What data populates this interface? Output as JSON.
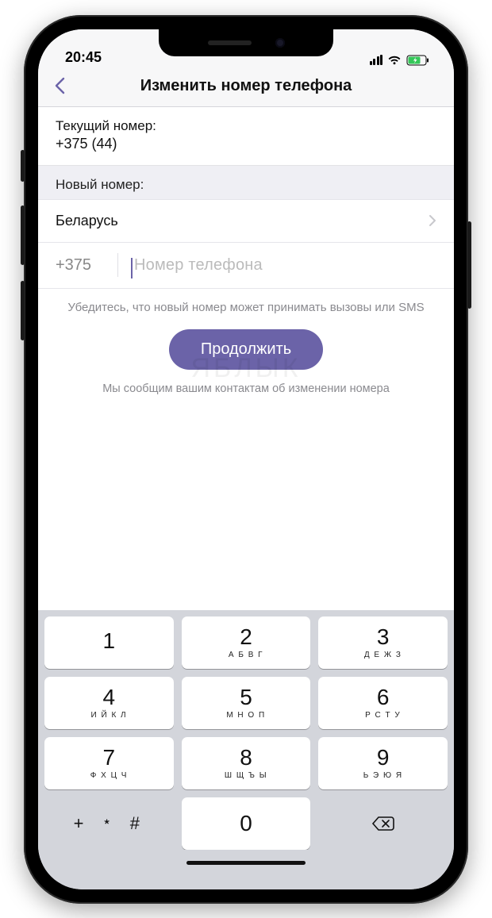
{
  "status": {
    "time": "20:45"
  },
  "nav": {
    "title": "Изменить номер телефона"
  },
  "current": {
    "label": "Текущий номер:",
    "value": "+375 (44)"
  },
  "new": {
    "header": "Новый номер:",
    "country": "Беларусь",
    "code": "+375",
    "placeholder": "Номер телефона"
  },
  "hints": {
    "verify": "Убедитесь, что новый номер может принимать вызовы или SMS",
    "notify": "Мы сообщим вашим контактам об изменении номера"
  },
  "cta": "Продолжить",
  "watermark": "ЯБЛЫК",
  "keypad": {
    "keys": [
      {
        "d": "1",
        "l": ""
      },
      {
        "d": "2",
        "l": "А Б В Г"
      },
      {
        "d": "3",
        "l": "Д Е Ж З"
      },
      {
        "d": "4",
        "l": "И Й К Л"
      },
      {
        "d": "5",
        "l": "М Н О П"
      },
      {
        "d": "6",
        "l": "Р С Т У"
      },
      {
        "d": "7",
        "l": "Ф Х Ц Ч"
      },
      {
        "d": "8",
        "l": "Ш Щ Ъ Ы"
      },
      {
        "d": "9",
        "l": "Ь Э Ю Я"
      }
    ],
    "symbols": "+ ﹡ #",
    "zero": "0"
  }
}
